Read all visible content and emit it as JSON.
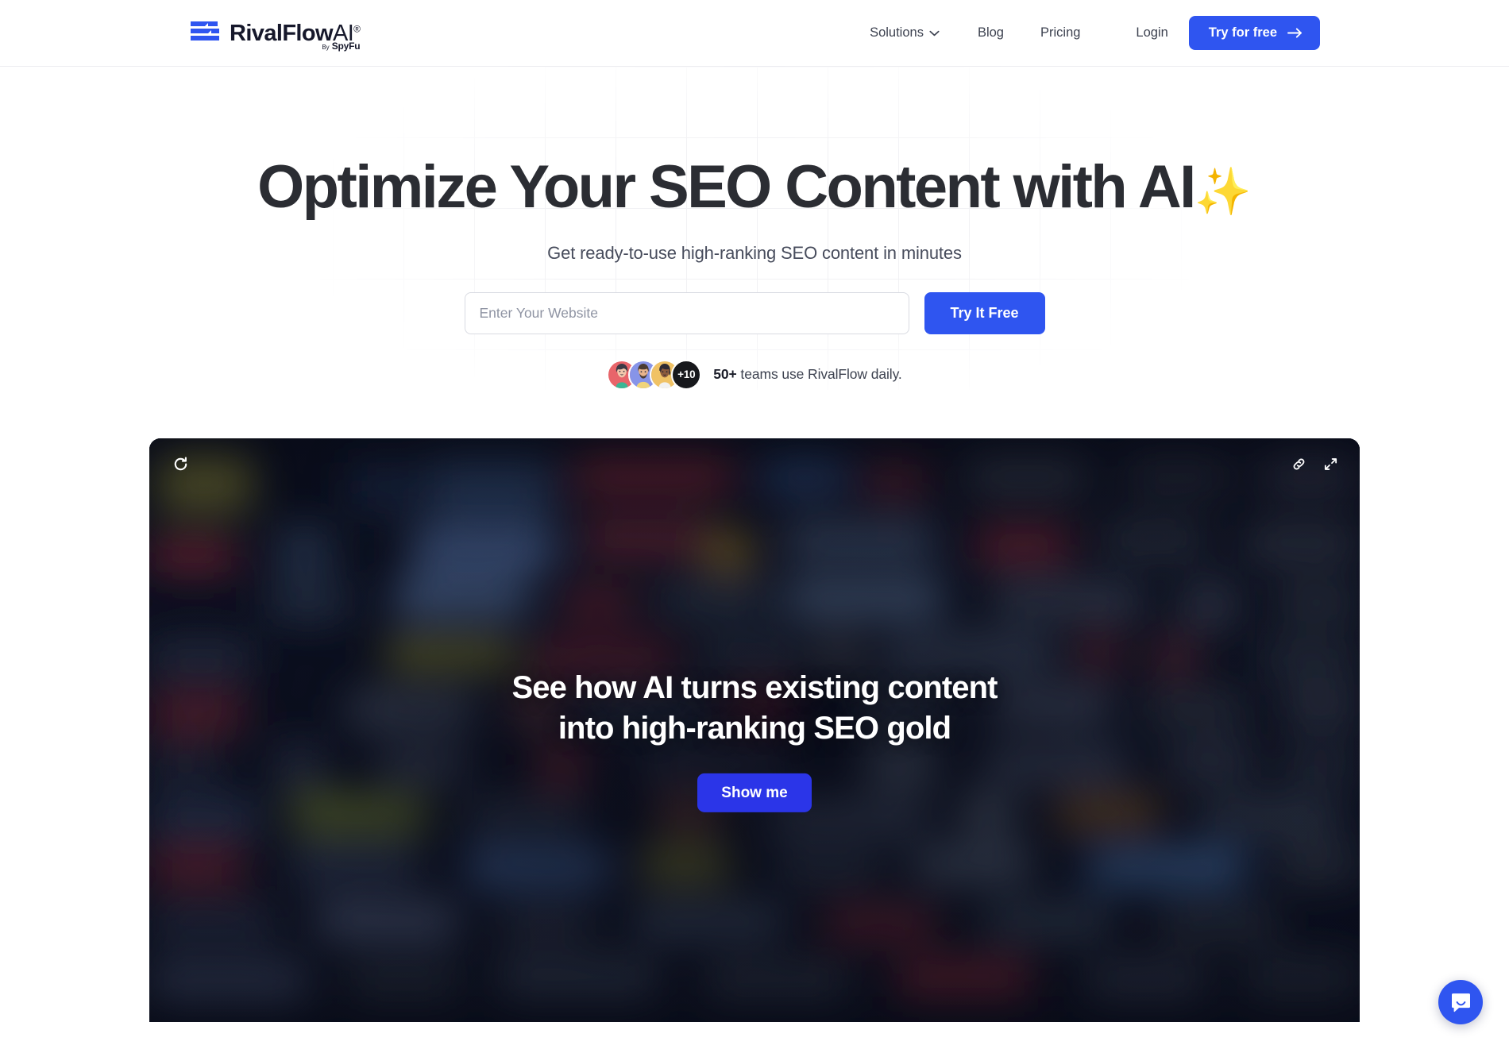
{
  "brand": {
    "name": "RivalFlowAI",
    "name_main": "RivalFlow",
    "name_ai": "AI",
    "registered_mark": "®",
    "byline_prefix": "By",
    "byline_company": "SpyFu",
    "accent_color": "#2f55f0",
    "logo_icon": "rivalflow-bars-logo"
  },
  "nav": {
    "items": [
      {
        "label": "Solutions",
        "has_dropdown": true,
        "icon": "chevron-down-icon"
      },
      {
        "label": "Blog",
        "has_dropdown": false
      },
      {
        "label": "Pricing",
        "has_dropdown": false
      },
      {
        "label": "Login",
        "has_dropdown": false
      }
    ],
    "cta": {
      "label": "Try for free",
      "icon": "arrow-right-icon"
    }
  },
  "hero": {
    "title_text": "Optimize Your SEO Content with AI",
    "title_emoji": "✨",
    "subtitle": "Get ready-to-use high-ranking SEO content in minutes",
    "form": {
      "input_placeholder": "Enter Your Website",
      "input_value": "",
      "submit_label": "Try It Free"
    },
    "social_proof": {
      "more_count": "+10",
      "count_label": "50+",
      "text": " teams use RivalFlow daily.",
      "avatar_count": 3
    }
  },
  "demo": {
    "toolbar": {
      "replay_icon": "refresh-icon",
      "link_icon": "link-icon",
      "expand_icon": "expand-icon"
    },
    "heading_line1": "See how AI turns existing content",
    "heading_line2": "into high-ranking SEO gold",
    "cta_label": "Show me",
    "cta_color": "#2b35e8"
  },
  "chat_widget": {
    "icon": "chat-bubble-icon",
    "color": "#2f55f0"
  }
}
